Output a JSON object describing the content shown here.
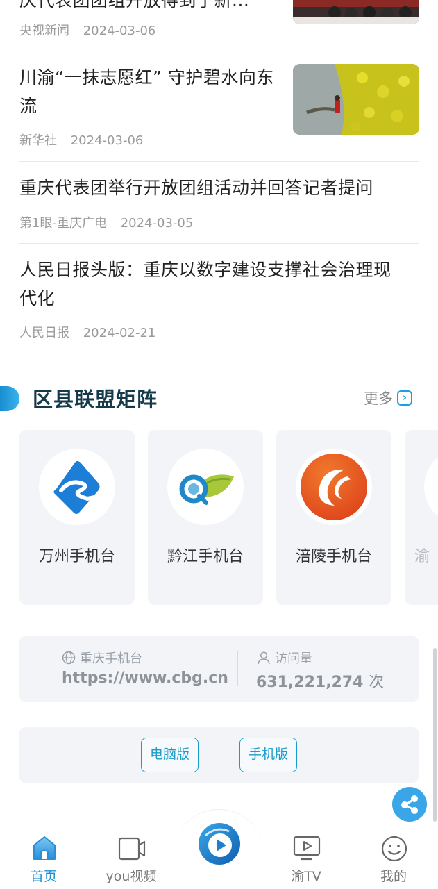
{
  "news": [
    {
      "title": "庆代表团团组开放得到了新...",
      "source": "央视新闻",
      "date": "2024-03-06"
    },
    {
      "title": "川渝“一抹志愿红” 守护碧水向东流",
      "source": "新华社",
      "date": "2024-03-06"
    },
    {
      "title": "重庆代表团举行开放团组活动并回答记者提问",
      "source": "第1眼-重庆广电",
      "date": "2024-03-05"
    },
    {
      "title": "人民日报头版：重庆以数字建设支撑社会治理现代化",
      "source": "人民日报",
      "date": "2024-02-21"
    }
  ],
  "matrix": {
    "title": "区县联盟矩阵",
    "more_label": "更多",
    "cards": [
      {
        "label": "万州手机台",
        "icon": "wanzhou-logo-icon"
      },
      {
        "label": "黔江手机台",
        "icon": "qianjiang-logo-icon"
      },
      {
        "label": "涪陵手机台",
        "icon": "fuling-logo-icon"
      },
      {
        "label": "渝",
        "icon": "yu-logo-icon"
      }
    ]
  },
  "site_info": {
    "site_label": "重庆手机台",
    "site_url": "https://www.cbg.cn",
    "visits_label": "访问量",
    "visits_value": "631,221,274",
    "visits_unit": "次"
  },
  "versions": {
    "pc_label": "电脑版",
    "mobile_label": "手机版"
  },
  "tabbar": {
    "tabs": [
      {
        "label": "首页",
        "icon": "home-icon",
        "active": true
      },
      {
        "label": "you视频",
        "icon": "video-icon",
        "active": false
      },
      {
        "label": "渝TV",
        "icon": "tv-icon",
        "active": false
      },
      {
        "label": "我的",
        "icon": "profile-icon",
        "active": false
      }
    ]
  },
  "colors": {
    "accent": "#1a8fd0",
    "title_dark": "#153a4a",
    "card_bg": "#f2f4f8"
  }
}
